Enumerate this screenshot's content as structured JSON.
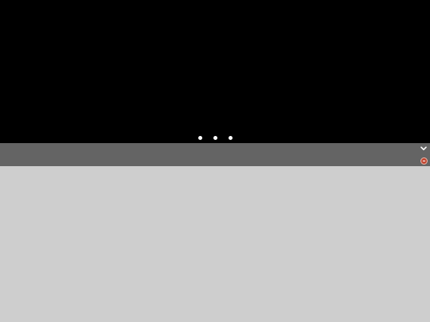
{
  "viewer": {
    "state": "loading",
    "loading_dots_count": 3,
    "background": "#000000",
    "dot_color": "#ffffff"
  },
  "toolbar": {
    "background": "#646464",
    "chevron_icon": "chevron-down-icon",
    "status_icon": "error-badge-icon",
    "status_color": "#c24a35"
  },
  "content": {
    "background": "#cecece"
  }
}
